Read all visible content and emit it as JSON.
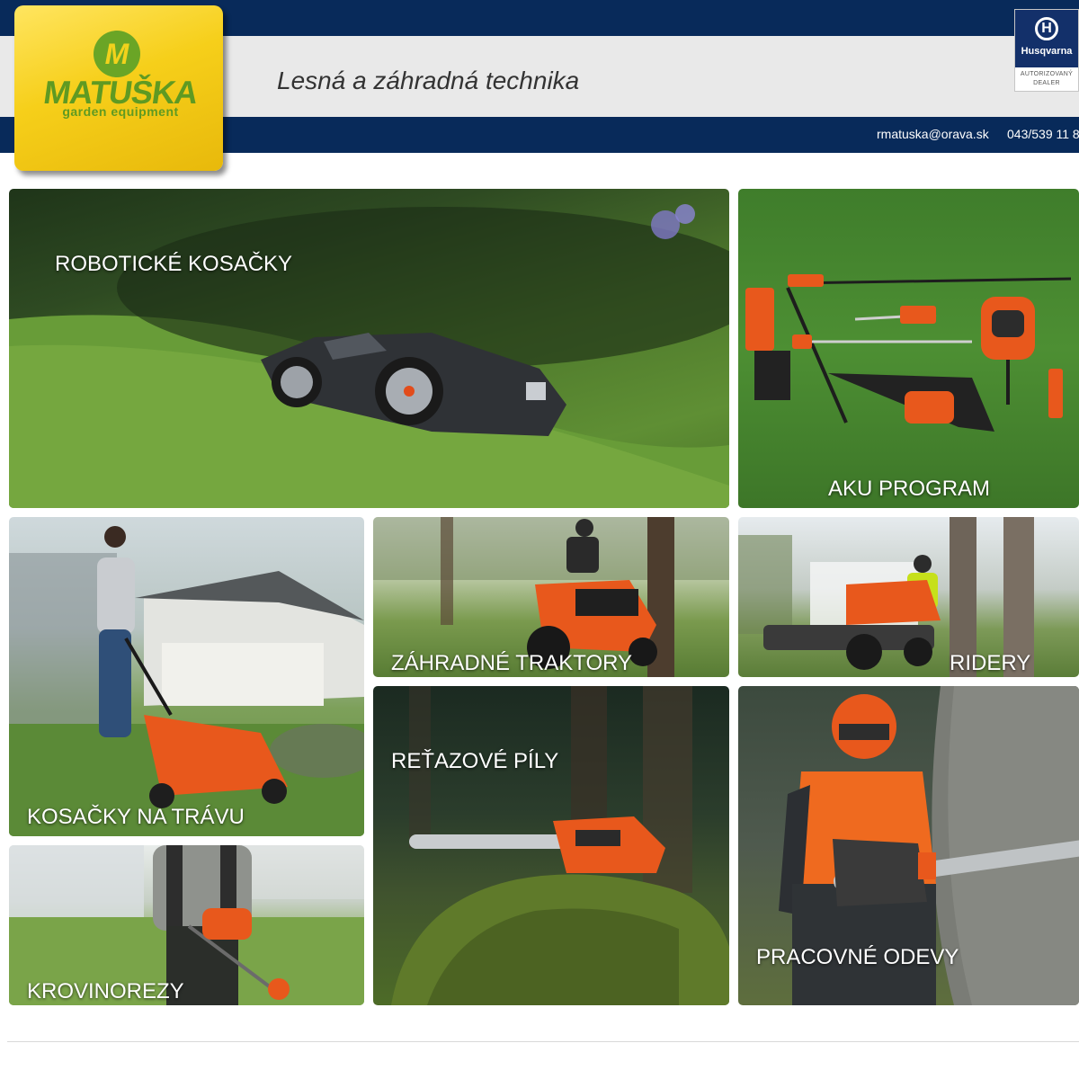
{
  "header": {
    "tagline": "Lesná a záhradná technika",
    "email": "rmatuska@orava.sk",
    "phone": "043/539 11 8"
  },
  "logo": {
    "monogram": "M",
    "name": "MATUŠKA",
    "subtitle": "garden equipment"
  },
  "dealer_badge": {
    "brand": "Husqvarna",
    "line1": "AUTORIZOVANÝ",
    "line2": "DEALER"
  },
  "categories": [
    {
      "label": "ROBOTICKÉ KOSAČKY"
    },
    {
      "label": "AKU PROGRAM"
    },
    {
      "label": "KOSAČKY NA TRÁVU"
    },
    {
      "label": "ZÁHRADNÉ TRAKTORY"
    },
    {
      "label": "RIDERY"
    },
    {
      "label": "REŤAZOVÉ PÍLY"
    },
    {
      "label": "PRACOVNÉ ODEVY"
    },
    {
      "label": "KROVINOREZY"
    }
  ],
  "colors": {
    "header_navy": "#082a5a",
    "header_gray": "#e9e9e9",
    "logo_yellow": "#f6cf1a",
    "logo_green": "#5f9a22",
    "husqvarna_orange": "#e8581c"
  }
}
